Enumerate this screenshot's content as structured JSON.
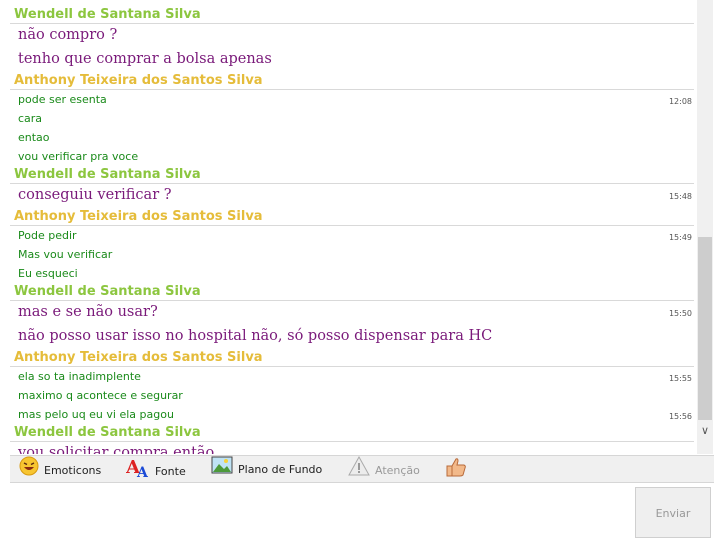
{
  "colors": {
    "wendell": "#8cc63f",
    "anthony": "#e5bc3a",
    "wendell_msg": "#7a1a7a",
    "anthony_msg": "#1a8a1a"
  },
  "conversation": [
    {
      "sender": "Wendell de Santana Silva",
      "who": "wendell",
      "style": "big",
      "messages": [
        {
          "text": "não compro ?",
          "time": ""
        },
        {
          "text": "tenho que comprar a bolsa apenas",
          "time": ""
        }
      ]
    },
    {
      "sender": "Anthony Teixeira dos Santos Silva",
      "who": "anthony",
      "style": "small",
      "messages": [
        {
          "text": "pode ser esenta",
          "time": "12:08"
        },
        {
          "text": "cara",
          "time": ""
        },
        {
          "text": "entao",
          "time": ""
        },
        {
          "text": "vou verificar pra voce",
          "time": ""
        }
      ]
    },
    {
      "sender": "Wendell de Santana Silva",
      "who": "wendell",
      "style": "big",
      "messages": [
        {
          "text": "conseguiu verificar ?",
          "time": "15:48"
        }
      ]
    },
    {
      "sender": "Anthony Teixeira dos Santos Silva",
      "who": "anthony",
      "style": "small",
      "messages": [
        {
          "text": "Pode pedir",
          "time": "15:49"
        },
        {
          "text": "Mas vou verificar",
          "time": ""
        },
        {
          "text": "Eu esqueci",
          "time": ""
        }
      ]
    },
    {
      "sender": "Wendell de Santana Silva",
      "who": "wendell",
      "style": "big",
      "messages": [
        {
          "text": "mas e se não usar?",
          "time": "15:50"
        },
        {
          "text": "não posso usar isso no hospital não, só posso dispensar para HC",
          "time": ""
        }
      ]
    },
    {
      "sender": "Anthony Teixeira dos Santos Silva",
      "who": "anthony",
      "style": "small",
      "messages": [
        {
          "text": "ela so ta inadimplente",
          "time": "15:55"
        },
        {
          "text": "maximo q acontece e segurar",
          "time": ""
        },
        {
          "text": "mas pelo uq eu vi ela pagou",
          "time": "15:56"
        }
      ]
    },
    {
      "sender": "Wendell de Santana Silva",
      "who": "wendell",
      "style": "big",
      "messages": [
        {
          "text": "vou solicitar compra então",
          "time": ""
        }
      ]
    }
  ],
  "toolbar": {
    "emoticons": {
      "label": "Emoticons",
      "icon": "emoticon-icon"
    },
    "font": {
      "label": "Fonte",
      "icon": "font-icon"
    },
    "background": {
      "label": "Plano de Fundo",
      "icon": "picture-icon"
    },
    "attention": {
      "label": "Atenção",
      "icon": "warning-icon"
    },
    "like": {
      "icon": "thumbs-up-icon"
    }
  },
  "composer": {
    "value": "",
    "placeholder": ""
  },
  "send_label": "Enviar"
}
